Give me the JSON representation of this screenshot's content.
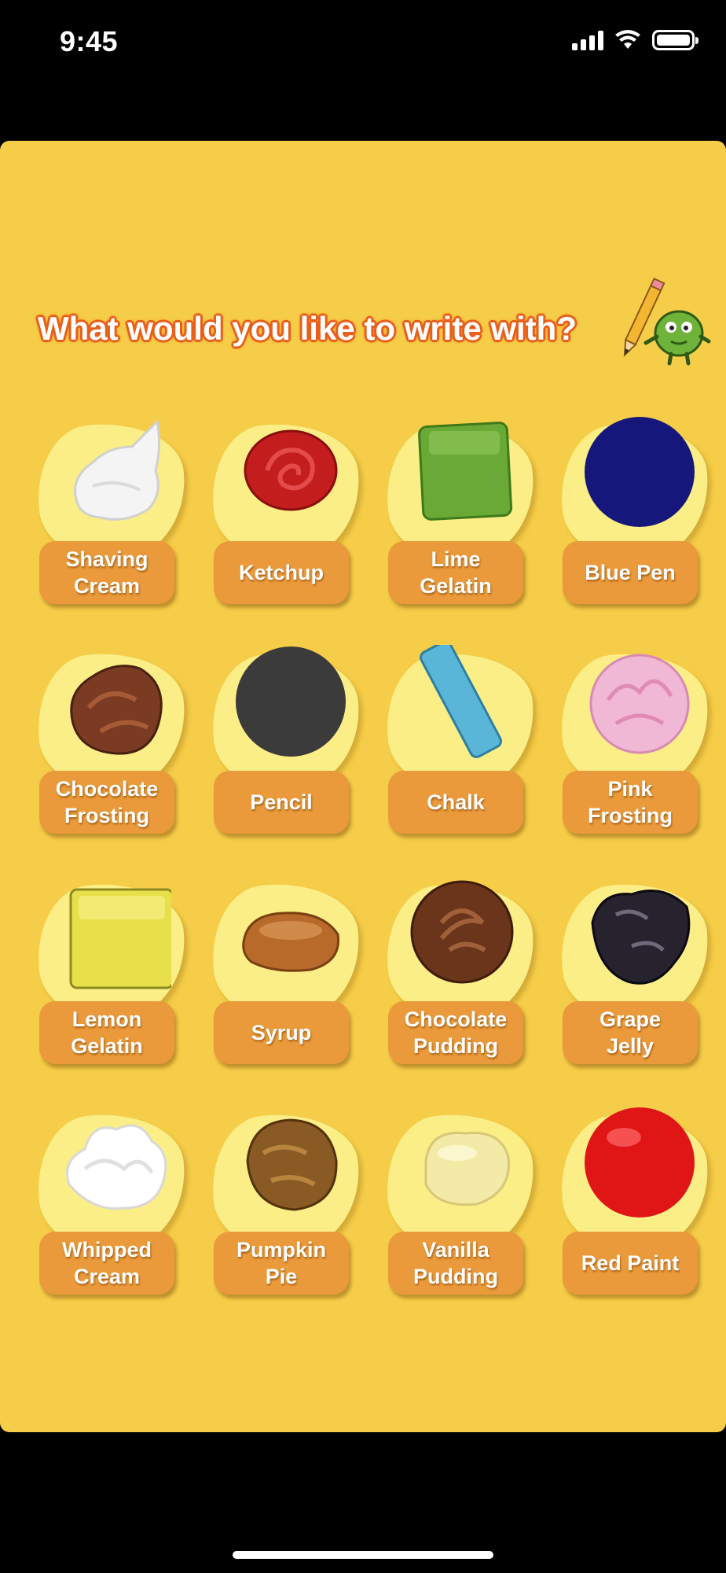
{
  "status_bar": {
    "time": "9:45"
  },
  "header": {
    "title": "What would you like to write with?"
  },
  "items": [
    {
      "label": "Shaving\nCream",
      "icon": "shaving-cream-icon",
      "color": "#f4f4f4"
    },
    {
      "label": "Ketchup",
      "icon": "ketchup-icon",
      "color": "#c41d1d"
    },
    {
      "label": "Lime\nGelatin",
      "icon": "lime-gelatin-icon",
      "color": "#6aa935"
    },
    {
      "label": "Blue Pen",
      "icon": "blue-pen-icon",
      "color": "#15177a"
    },
    {
      "label": "Chocolate\nFrosting",
      "icon": "chocolate-frosting-icon",
      "color": "#7a3b22"
    },
    {
      "label": "Pencil",
      "icon": "pencil-icon",
      "color": "#3b3b3b"
    },
    {
      "label": "Chalk",
      "icon": "chalk-icon",
      "color": "#5ab6d8"
    },
    {
      "label": "Pink\nFrosting",
      "icon": "pink-frosting-icon",
      "color": "#f0b8d4"
    },
    {
      "label": "Lemon\nGelatin",
      "icon": "lemon-gelatin-icon",
      "color": "#e8e04a"
    },
    {
      "label": "Syrup",
      "icon": "syrup-icon",
      "color": "#b86a2a"
    },
    {
      "label": "Chocolate\nPudding",
      "icon": "chocolate-pudding-icon",
      "color": "#6a351a"
    },
    {
      "label": "Grape\nJelly",
      "icon": "grape-jelly-icon",
      "color": "#26222e"
    },
    {
      "label": "Whipped\nCream",
      "icon": "whipped-cream-icon",
      "color": "#ffffff"
    },
    {
      "label": "Pumpkin\nPie",
      "icon": "pumpkin-pie-icon",
      "color": "#8a5a24"
    },
    {
      "label": "Vanilla\nPudding",
      "icon": "vanilla-pudding-icon",
      "color": "#f4eaa8"
    },
    {
      "label": "Red Paint",
      "icon": "red-paint-icon",
      "color": "#e01616"
    }
  ]
}
